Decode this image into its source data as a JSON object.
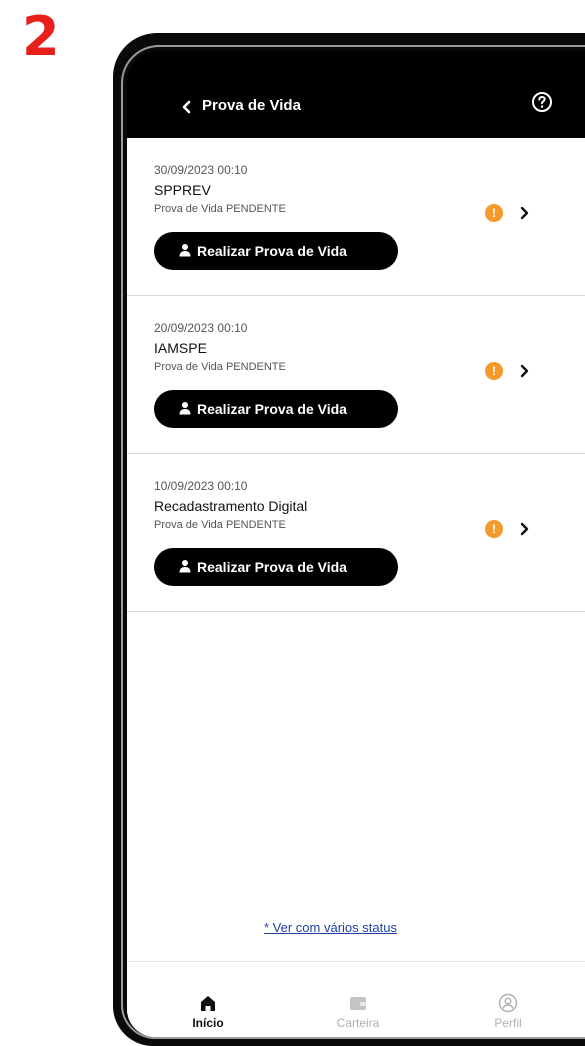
{
  "step_number": "2",
  "header": {
    "title": "Prova de Vida"
  },
  "items": [
    {
      "date": "30/09/2023  00:10",
      "name": "SPPREV",
      "status": "Prova de Vida PENDENTE",
      "action_label": "Realizar Prova de Vida"
    },
    {
      "date": "20/09/2023  00:10",
      "name": "IAMSPE",
      "status": "Prova de Vida PENDENTE",
      "action_label": "Realizar Prova de Vida"
    },
    {
      "date": "10/09/2023  00:10",
      "name": "Recadastramento Digital",
      "status": "Prova de Vida PENDENTE",
      "action_label": "Realizar Prova de Vida"
    }
  ],
  "status_link": "* Ver com vários status",
  "bottom_nav": [
    {
      "label": "Início",
      "icon": "home-icon",
      "active": true
    },
    {
      "label": "Carteira",
      "icon": "wallet-icon",
      "active": false
    },
    {
      "label": "Perfil",
      "icon": "profile-icon",
      "active": false
    }
  ],
  "colors": {
    "accent": "#000000",
    "warning": "#f49a2c",
    "link": "#1f3fa8",
    "step_number": "#e8201c",
    "nav_inactive": "#b0b0b0"
  }
}
